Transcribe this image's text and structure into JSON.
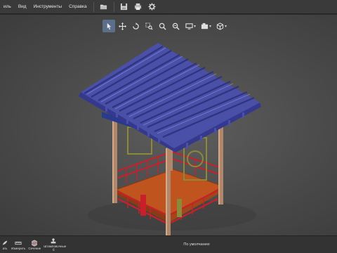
{
  "menu": {
    "items": [
      {
        "label": "иль",
        "name": "menu-file"
      },
      {
        "label": "Вид",
        "name": "menu-view"
      },
      {
        "label": "Инструменты",
        "name": "menu-tools"
      },
      {
        "label": "Справка",
        "name": "menu-help"
      }
    ]
  },
  "toolbar": {
    "icons": [
      "open-folder-icon",
      "save-icon",
      "print-icon",
      "settings-icon"
    ]
  },
  "viewport_toolbar": {
    "icons": [
      "select-arrow-icon",
      "pan-icon",
      "rotate-icon",
      "zoom-window-icon",
      "zoom-icon",
      "zoom-fit-icon",
      "display-mode-icon",
      "camera-view-icon",
      "cube-view-icon"
    ],
    "active": "select-arrow-icon"
  },
  "status_tools": [
    {
      "label": "ать",
      "icon": "markup-icon"
    },
    {
      "label": "Измерить",
      "icon": "measure-icon"
    },
    {
      "label": "Сечение",
      "icon": "section-icon"
    },
    {
      "label": "Штамповочные б",
      "icon": "stamp-icon"
    }
  ],
  "status": {
    "text": "По умолчанию"
  },
  "colors": {
    "roof_tiles": "#4a4fa8",
    "wood_posts": "#b0876a",
    "floor": "#c0541e",
    "railing": "#c8202a",
    "bracket_green": "#3fb846",
    "window_frame": "#8a8a3a"
  }
}
